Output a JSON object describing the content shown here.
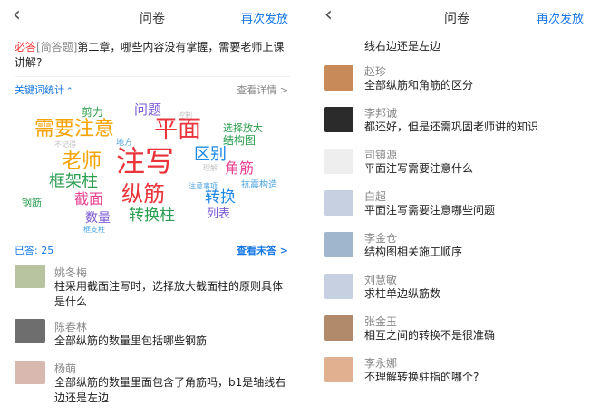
{
  "header": {
    "back_icon": "chevron-left-icon",
    "title": "问卷",
    "resend": "再次发放"
  },
  "question": {
    "required": "必答",
    "type": "[简答题]",
    "text": "第二章，哪些内容没有掌握，需要老师上课讲解?"
  },
  "keywords": {
    "label": "关键词统计",
    "toggle_icon": "chevron-up-icon",
    "detail": "查看详情 >",
    "words": [
      {
        "text": "剪力",
        "color": "#2a9d4e"
      },
      {
        "text": "问题",
        "color": "#7b5bd6"
      },
      {
        "text": "控制",
        "color": "#c0c0c0"
      },
      {
        "text": "需要注意",
        "color": "#f5a300"
      },
      {
        "text": "平面",
        "color": "#e8343a"
      },
      {
        "text": "选择放大",
        "color": "#2a9d4e"
      },
      {
        "text": "结构图",
        "color": "#2a9d4e"
      },
      {
        "text": "不记得",
        "color": "#c0c0c0"
      },
      {
        "text": "地方",
        "color": "#4aa3df"
      },
      {
        "text": "区别",
        "color": "#1e88e5"
      },
      {
        "text": "老师",
        "color": "#f5a300"
      },
      {
        "text": "注写",
        "color": "#e8343a"
      },
      {
        "text": "理解",
        "color": "#c0c0c0"
      },
      {
        "text": "角筋",
        "color": "#e84393"
      },
      {
        "text": "框架柱",
        "color": "#2a9d4e"
      },
      {
        "text": "注意事项",
        "color": "#4aa3df"
      },
      {
        "text": "抗震构造",
        "color": "#4aa3df"
      },
      {
        "text": "钢筋",
        "color": "#2a9d4e"
      },
      {
        "text": "截面",
        "color": "#e84393"
      },
      {
        "text": "纵筋",
        "color": "#e8343a"
      },
      {
        "text": "转换",
        "color": "#1e88e5"
      },
      {
        "text": "数量",
        "color": "#7b5bd6"
      },
      {
        "text": "转换柱",
        "color": "#2a9d4e"
      },
      {
        "text": "列表",
        "color": "#7b5bd6"
      },
      {
        "text": "框支柱",
        "color": "#4aa3df"
      }
    ]
  },
  "answered": "已答: 25",
  "unanswered": "查看未答 >",
  "left_entries": [
    {
      "name": "姚冬梅",
      "text": "柱采用截面注写时，选择放大截面柱的原则具体是什么",
      "avatar_color": "#b8c4a0"
    },
    {
      "name": "陈春林",
      "text": "全部纵筋的数量里包括哪些钢筋",
      "avatar_color": "#6e6e6e"
    },
    {
      "name": "杨萌",
      "text": "全部纵筋的数量里面包含了角筋吗，b1是轴线右边还是左边",
      "avatar_color": "#d9b8b0"
    }
  ],
  "right_top_text": "线右边还是左边",
  "right_entries": [
    {
      "name": "赵珍",
      "text": "全部纵筋和角筋的区分",
      "avatar_color": "#c98a5a"
    },
    {
      "name": "李邦诚",
      "text": "都还好，但是还需巩固老师讲的知识",
      "avatar_color": "#2b2b2b"
    },
    {
      "name": "司镇源",
      "text": "平面注写需要注意什么",
      "avatar_color": "#eeeeee"
    },
    {
      "name": "白超",
      "text": "平面注写需要注意哪些问题",
      "avatar_color": "#c6d0e0"
    },
    {
      "name": "李金仓",
      "text": "结构图相关施工顺序",
      "avatar_color": "#9fb6cc"
    },
    {
      "name": "刘慧敏",
      "text": "求柱单边纵筋数",
      "avatar_color": "#c6d0e0"
    },
    {
      "name": "张金玉",
      "text": "相互之间的转换不是很准确",
      "avatar_color": "#b08a6a"
    },
    {
      "name": "李永娜",
      "text": "不理解转换驻指的哪个?",
      "avatar_color": "#e0b090"
    }
  ]
}
